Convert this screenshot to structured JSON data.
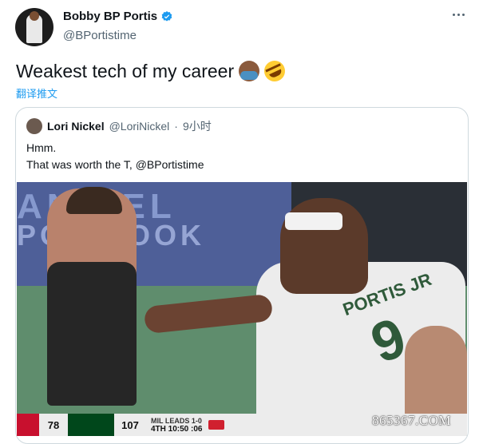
{
  "tweet": {
    "author": {
      "display_name": "Bobby BP Portis",
      "handle": "@BPortistime"
    },
    "text": "Weakest tech of my career",
    "translate_label": "翻译推文"
  },
  "quote": {
    "author": {
      "display_name": "Lori Nickel",
      "handle": "@LoriNickel",
      "separator": "·",
      "time": "9小时"
    },
    "text_lines": [
      "Hmm.",
      "That was worth the T, @BPortistime"
    ]
  },
  "media": {
    "board_text_1": "AN  UEL",
    "board_text_2": "POR  BOOK",
    "jersey_name": "PORTIS JR",
    "jersey_number": "9",
    "scorebar": {
      "score_1": "78",
      "score_2": "107",
      "series": "MIL LEADS 1-0",
      "period_clock": "4TH  10:50  :06"
    }
  },
  "watermark": "865367.COM",
  "colors": {
    "accent": "#1d9bf0",
    "secondary_text": "#536471",
    "border": "#cfd9de"
  }
}
